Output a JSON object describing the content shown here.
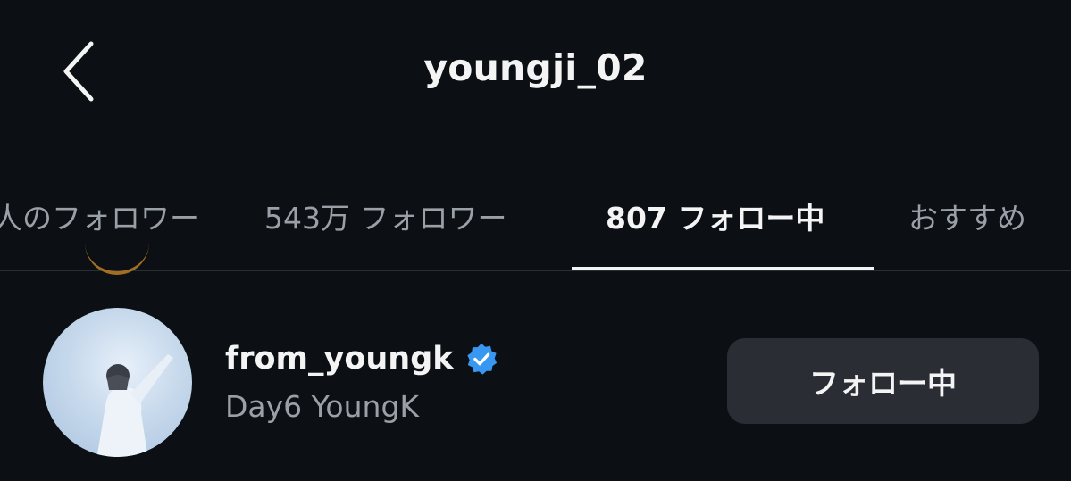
{
  "header": {
    "title": "youngji_02",
    "back_icon": "chevron-left-icon"
  },
  "tabs": [
    {
      "label": "人のフォロワー"
    },
    {
      "label": "543万 フォロワー"
    },
    {
      "label": "807 フォロー中",
      "active": true
    },
    {
      "label": "おすすめ"
    }
  ],
  "list": {
    "items": [
      {
        "username": "from_youngk",
        "verified": true,
        "full_name": "Day6 YoungK",
        "button_label": "フォロー中"
      }
    ]
  },
  "colors": {
    "background": "#0c0f14",
    "verified_badge": "#3897f0",
    "button_bg": "#2a2d34",
    "muted_text": "#9aa0a8"
  }
}
